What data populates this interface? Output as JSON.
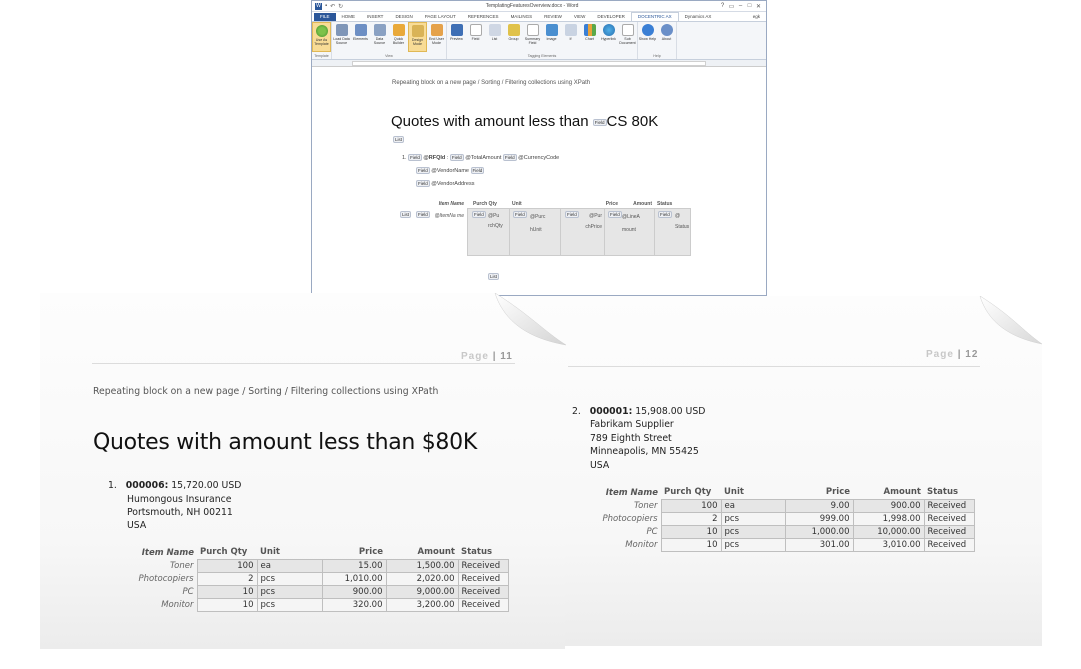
{
  "word": {
    "title": "TemplatingFeaturesOverview.docx - Word",
    "file_tab": "FILE",
    "tabs": [
      "HOME",
      "INSERT",
      "DESIGN",
      "PAGE LAYOUT",
      "REFERENCES",
      "MAILINGS",
      "REVIEW",
      "VIEW",
      "DEVELOPER",
      "DOCENTRIC AX",
      "Dynamics AX"
    ],
    "active_tab": "DOCENTRIC AX",
    "user": "egk",
    "ribbon": {
      "template_group": {
        "label": "Template",
        "buttons": [
          "Use As Template"
        ]
      },
      "view_group": {
        "label": "View",
        "buttons": [
          "Load Data Source",
          "Elements",
          "Data Source",
          "Quick Builder",
          "Design Mode",
          "End User Mode"
        ]
      },
      "tagging_group": {
        "label": "Tagging Elements",
        "buttons": [
          "Preview",
          "Field",
          "List",
          "Group",
          "Summary Field",
          "Image",
          "If",
          "Chart",
          "Hyperlink",
          "Sub Document"
        ]
      },
      "help_group": {
        "label": "Help",
        "buttons": [
          "Show Help",
          "About"
        ]
      }
    },
    "doc": {
      "subtitle": "Repeating block on a new page / Sorting / Filtering collections using XPath",
      "heading_pre": "Quotes with amount less than",
      "heading_field": "Field",
      "heading_post": "CS  80K",
      "list_tag": "List",
      "field_tag": "Field",
      "list_num": "1.",
      "rfqid": "@RFQId",
      "colon": ":",
      "total_amount": "@TotalAmount",
      "currency": "@CurrencyCode",
      "vendor_name": "@VendorName",
      "vendor_address": "@VendorAddress",
      "headers": [
        "Item Name",
        "Purch Qty",
        "Unit",
        "Price",
        "Amount",
        "Status"
      ],
      "cells": [
        "@ItemNa me",
        "@Pu rchQty",
        "@Purc hUnit",
        "@Pur chPrice",
        "@LineA mount",
        "@ Status"
      ]
    }
  },
  "page11": {
    "page_label": "Page",
    "page_number": "11",
    "subtitle": "Repeating block on a new page / Sorting / Filtering collections using XPath",
    "title": "Quotes with amount less than $80K",
    "quote": {
      "num": "1.",
      "id": "000006:",
      "amount": "15,720.00 USD",
      "vendor": "Humongous Insurance",
      "address": "Portsmouth, NH 00211",
      "country": "USA"
    },
    "headers": [
      "Item Name",
      "Purch Qty",
      "Unit",
      "Price",
      "Amount",
      "Status"
    ],
    "rows": [
      [
        "Toner",
        "100",
        "ea",
        "15.00",
        "1,500.00",
        "Received"
      ],
      [
        "Photocopiers",
        "2",
        "pcs",
        "1,010.00",
        "2,020.00",
        "Received"
      ],
      [
        "PC",
        "10",
        "pcs",
        "900.00",
        "9,000.00",
        "Received"
      ],
      [
        "Monitor",
        "10",
        "pcs",
        "320.00",
        "3,200.00",
        "Received"
      ]
    ]
  },
  "page12": {
    "page_label": "Page",
    "page_number": "12",
    "quote": {
      "num": "2.",
      "id": "000001:",
      "amount": "15,908.00 USD",
      "vendor": "Fabrikam Supplier",
      "address1": "789 Eighth Street",
      "address2": "Minneapolis, MN 55425",
      "country": "USA"
    },
    "headers": [
      "Item Name",
      "Purch Qty",
      "Unit",
      "Price",
      "Amount",
      "Status"
    ],
    "rows": [
      [
        "Toner",
        "100",
        "ea",
        "9.00",
        "900.00",
        "Received"
      ],
      [
        "Photocopiers",
        "2",
        "pcs",
        "999.00",
        "1,998.00",
        "Received"
      ],
      [
        "PC",
        "10",
        "pcs",
        "1,000.00",
        "10,000.00",
        "Received"
      ],
      [
        "Monitor",
        "10",
        "pcs",
        "301.00",
        "3,010.00",
        "Received"
      ]
    ]
  }
}
